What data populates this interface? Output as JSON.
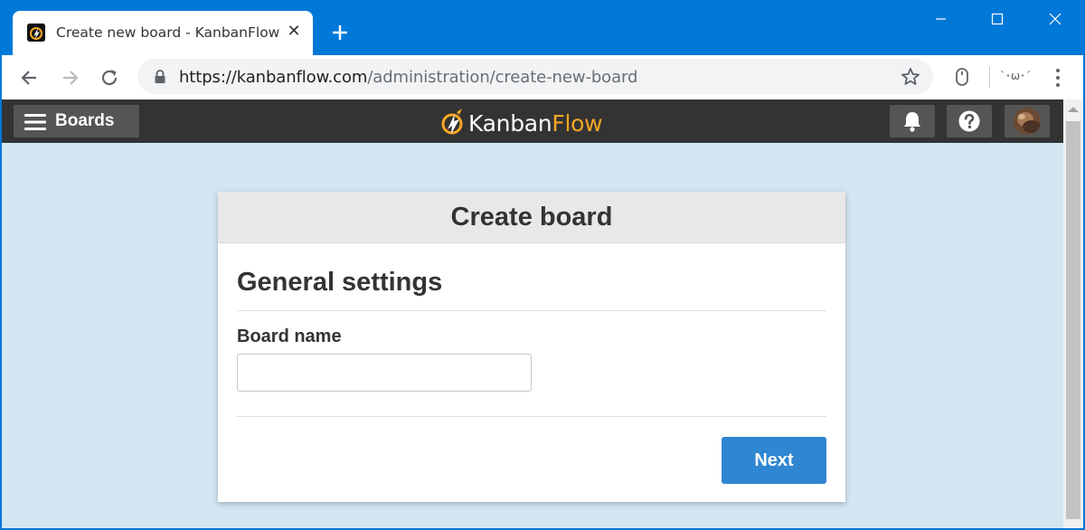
{
  "browser": {
    "tab_title": "Create new board - KanbanFlow",
    "tab_close_glyph": "✕",
    "url_host": "https://kanbanflow.com",
    "url_path": "/administration/create-new-board",
    "extension_text": "`･ω･´",
    "accent_color": "#0078d7"
  },
  "app": {
    "boards_label": "Boards",
    "logo_word_1": "Kanban",
    "logo_word_2": "Flow",
    "logo_accent_color": "#f5a623",
    "header_buttons": [
      "bell-icon",
      "help-icon",
      "avatar"
    ]
  },
  "dialog": {
    "title": "Create board",
    "section_title": "General settings",
    "field_label": "Board name",
    "field_value": "",
    "next_label": "Next",
    "button_color": "#2f86d1"
  }
}
